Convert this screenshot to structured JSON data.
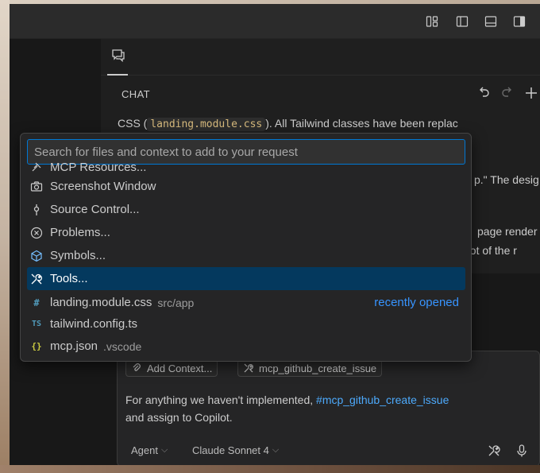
{
  "chat": {
    "title": "CHAT",
    "response_line1_a": "CSS (",
    "response_line1_code": "landing.module.css",
    "response_line1_b": "). All Tailwind classes have been replac",
    "response_line2": "p.\" The desig",
    "response_line3": "page render",
    "response_line4": "shot of the r"
  },
  "quickpick": {
    "placeholder": "Search for files and context to add to your request",
    "items": [
      {
        "label": "MCP Resources...",
        "icon": "mcp-icon"
      },
      {
        "label": "Screenshot Window",
        "icon": "camera-icon"
      },
      {
        "label": "Source Control...",
        "icon": "source-control-icon"
      },
      {
        "label": "Problems...",
        "icon": "problems-icon"
      },
      {
        "label": "Symbols...",
        "icon": "symbol-icon"
      },
      {
        "label": "Tools...",
        "icon": "tools-icon",
        "selected": true
      },
      {
        "label": "landing.module.css",
        "description": "src/app",
        "detail": "recently opened",
        "icon": "css-file-icon",
        "icon_text": "#"
      },
      {
        "label": "tailwind.config.ts",
        "icon": "ts-file-icon",
        "icon_text": "TS"
      },
      {
        "label": "mcp.json",
        "description": ".vscode",
        "icon": "json-file-icon",
        "icon_text": "{}"
      }
    ]
  },
  "input": {
    "add_context_label": "Add Context...",
    "tool_chip_label": "mcp_github_create_issue",
    "text_before": "For anything we haven't implemented, ",
    "text_ref": "#mcp_github_create_issue",
    "text_line2": "and assign to Copilot.",
    "mode_label": "Agent",
    "model_label": "Claude Sonnet 4"
  },
  "colors": {
    "accent": "#0078d4",
    "selection": "#04395e",
    "link": "#3794ff",
    "reference": "#4daafc",
    "code": "#d7ba7d"
  }
}
